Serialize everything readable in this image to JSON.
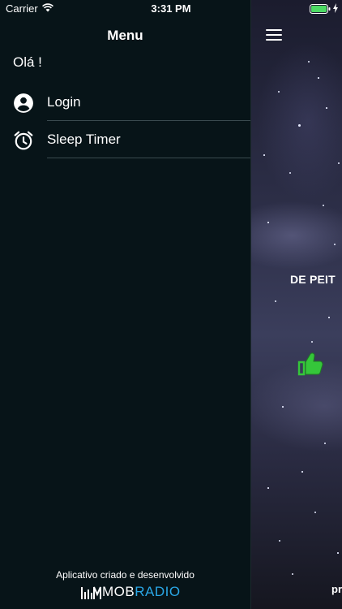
{
  "status_bar": {
    "carrier": "Carrier",
    "time": "3:31 PM",
    "battery_color": "#4cd964"
  },
  "drawer": {
    "title": "Menu",
    "greeting": "Olá !",
    "items": [
      {
        "label": "Login",
        "icon": "account-circle-icon"
      },
      {
        "label": "Sleep Timer",
        "icon": "alarm-clock-icon"
      }
    ],
    "footer": {
      "credit": "Aplicativo criado e desenvolvido",
      "logo_prefix": "MOB",
      "logo_suffix": "RADIO"
    }
  },
  "main": {
    "station_title": "DE PEIT",
    "bottom_text": "pr",
    "like_color": "#35c63a",
    "menu_icon": "hamburger-icon"
  }
}
